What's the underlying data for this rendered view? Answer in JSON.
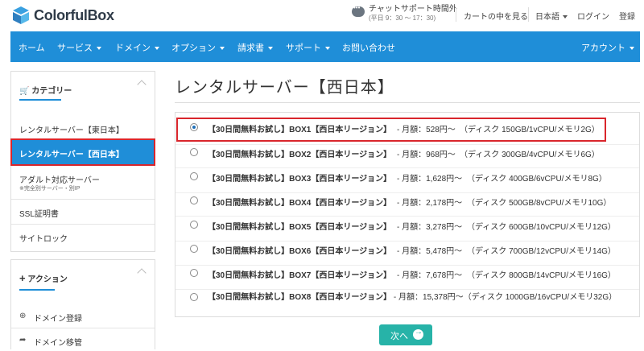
{
  "brand": {
    "name": "ColorfulBox"
  },
  "header": {
    "chat_title": "チャットサポート時間外",
    "chat_hours": "(平日 9：30 ～ 17：30)",
    "cart": "カートの中を見る",
    "language": "日本語",
    "login": "ログイン",
    "register": "登録"
  },
  "nav": {
    "home": "ホーム",
    "services": "サービス",
    "domains": "ドメイン",
    "options": "オプション",
    "billing": "請求書",
    "support": "サポート",
    "contact": "お問い合わせ",
    "account": "アカウント"
  },
  "sidebar": {
    "category_title": "カテゴリー",
    "items": [
      {
        "label": "レンタルサーバー【東日本】"
      },
      {
        "label": "レンタルサーバー【西日本】"
      },
      {
        "label": "アダルト対応サーバー",
        "sub": "※完全別サーバー・別IP"
      },
      {
        "label": "SSL証明書"
      },
      {
        "label": "サイトロック"
      }
    ],
    "action_title": "アクション",
    "actions": [
      {
        "label": "ドメイン登録"
      },
      {
        "label": "ドメイン移管"
      }
    ]
  },
  "main": {
    "title": "レンタルサーバー【西日本】",
    "options": [
      {
        "name": "【30日間無料お試し】BOX1【西日本リージョン】",
        "price": " - 月額：528円～",
        "spec": "（ディスク 150GB/1vCPU/メモリ2G）",
        "selected": true
      },
      {
        "name": "【30日間無料お試し】BOX2【西日本リージョン】",
        "price": " - 月額：968円～",
        "spec": "（ディスク 300GB/4vCPU/メモリ6G）",
        "selected": false
      },
      {
        "name": "【30日間無料お試し】BOX3【西日本リージョン】",
        "price": " - 月額：1,628円～",
        "spec": "（ディスク 400GB/6vCPU/メモリ8G）",
        "selected": false
      },
      {
        "name": "【30日間無料お試し】BOX4【西日本リージョン】",
        "price": " - 月額：2,178円～",
        "spec": "（ディスク 500GB/8vCPU/メモリ10G）",
        "selected": false
      },
      {
        "name": "【30日間無料お試し】BOX5【西日本リージョン】",
        "price": " - 月額：3,278円～",
        "spec": "（ディスク 600GB/10vCPU/メモリ12G）",
        "selected": false
      },
      {
        "name": "【30日間無料お試し】BOX6【西日本リージョン】",
        "price": " - 月額：5,478円～",
        "spec": "（ディスク 700GB/12vCPU/メモリ14G）",
        "selected": false
      },
      {
        "name": "【30日間無料お試し】BOX7【西日本リージョン】",
        "price": " - 月額：7,678円～",
        "spec": "（ディスク 800GB/14vCPU/メモリ16G）",
        "selected": false
      },
      {
        "name": "【30日間無料お試し】BOX8【西日本リージョン】",
        "price": " - 月額：15,378円～",
        "spec": "（ディスク 1000GB/16vCPU/メモリ32G）",
        "selected": false
      }
    ],
    "next_label": "次へ"
  },
  "colors": {
    "accent": "#1f8ed8",
    "highlight": "#d9262c",
    "button": "#27b3a8"
  },
  "icons": [
    "logo-cube-icon",
    "chat-icon",
    "cart-icon",
    "plus-icon",
    "globe-icon",
    "share-icon",
    "arrow-right-circle-icon"
  ]
}
